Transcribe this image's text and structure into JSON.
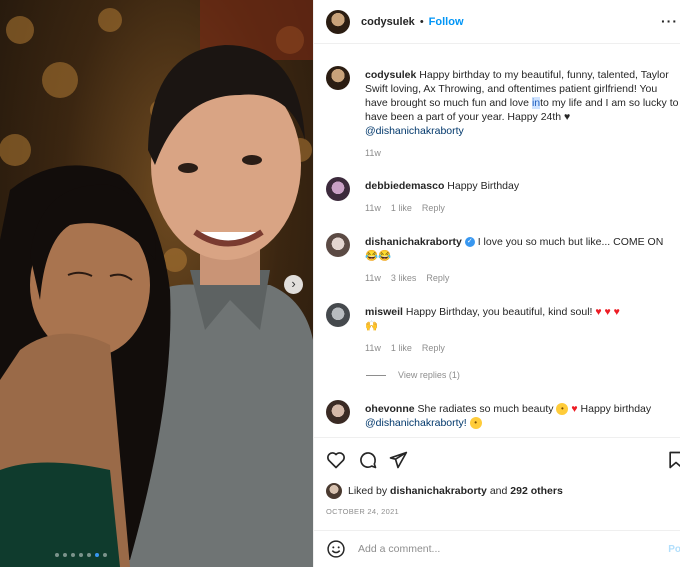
{
  "post": {
    "owner": "codysulek",
    "follow_label": "Follow",
    "separator": "•",
    "more_label": "···",
    "caption": {
      "username": "codysulek",
      "text_before": "Happy birthday to my beautiful, funny, talented, Taylor Swift loving, Ax Throwing, and oftentimes patient girlfriend! You have brought so much fun and love ",
      "highlighted": "in",
      "text_after": "to my life and I am so lucky to have been a part of your year. Happy 24th ♥",
      "mention": "@dishanichakraborty",
      "time": "11w"
    }
  },
  "comments": [
    {
      "username": "debbiedemasco",
      "text": "Happy Birthday",
      "time": "11w",
      "likes": "1 like",
      "reply": "Reply"
    },
    {
      "username": "dishanichakraborty",
      "verified": "✓",
      "text": "I love you so much but like... COME ON",
      "emoji_line": "😂😂",
      "time": "11w",
      "likes": "3 likes",
      "reply": "Reply"
    },
    {
      "username": "misweil",
      "text": "Happy Birthday, you beautiful, kind soul!",
      "hearts": "♥ ♥ ♥",
      "emoji_line": "🙌",
      "time": "11w",
      "likes": "1 like",
      "reply": "Reply"
    },
    {
      "username": "ohevonne",
      "text": "She radiates so much beauty",
      "hearts": "♥",
      "text2": "Happy birthday",
      "mention": "@dishanichakraborty!",
      "time": "",
      "likes": "",
      "reply": ""
    }
  ],
  "view_replies": "View replies (1)",
  "likes": {
    "prefix": "Liked by",
    "user": "dishanichakraborty",
    "conj": "and",
    "others": "292 others"
  },
  "date": "OCTOBER 24, 2021",
  "add_comment": {
    "placeholder": "Add a comment...",
    "post_label": "Po"
  },
  "icons": {
    "like": "heart-icon",
    "comment": "comment-icon",
    "share": "share-icon",
    "save": "bookmark-icon",
    "emoji": "emoji-icon",
    "next": "chevron-right-icon"
  },
  "colors": {
    "accent": "#0095f6",
    "mention": "#00376b",
    "muted": "#8e8e8e",
    "heart": "#ed1c24"
  },
  "carousel": {
    "count": 7,
    "active_index": 5,
    "next_glyph": "›"
  }
}
